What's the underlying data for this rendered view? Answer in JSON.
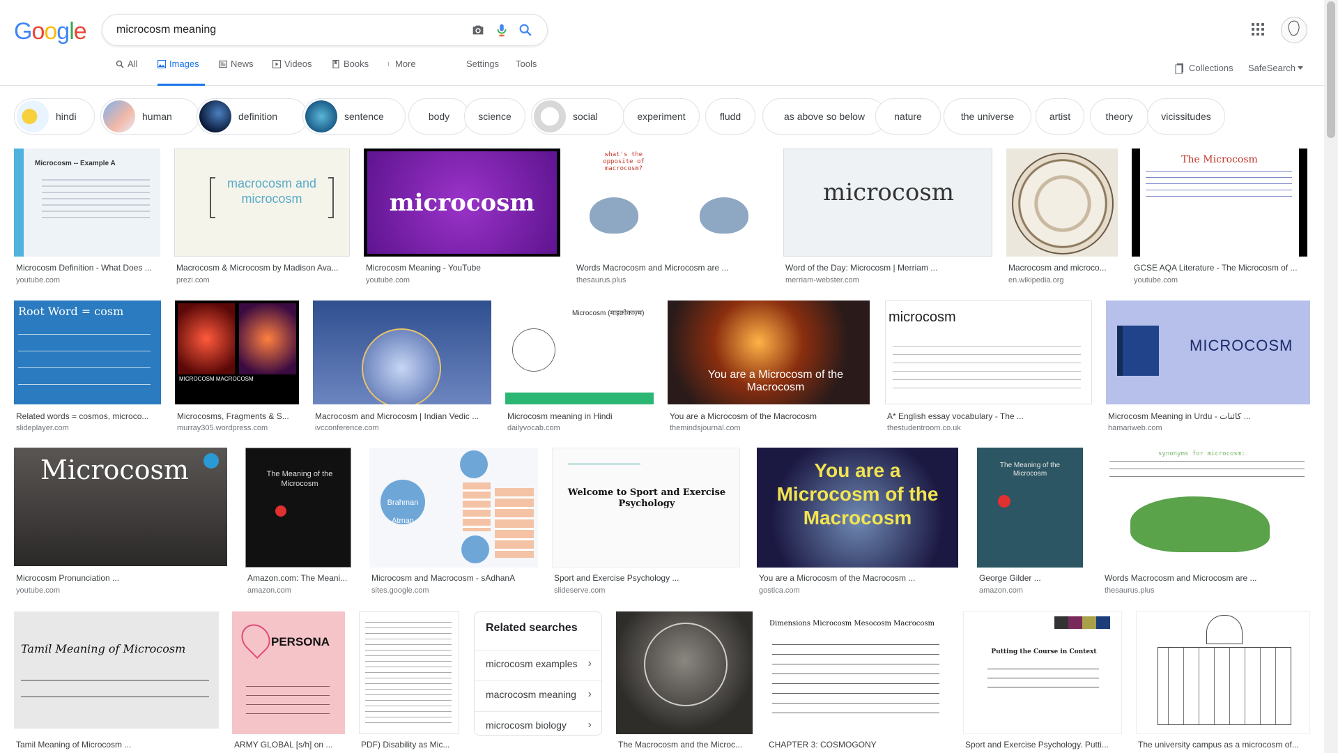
{
  "logo": {
    "letters": [
      "G",
      "o",
      "o",
      "g",
      "l",
      "e"
    ],
    "colors": [
      "#4285F4",
      "#EA4335",
      "#FBBC05",
      "#4285F4",
      "#34A853",
      "#EA4335"
    ]
  },
  "search": {
    "query": "microcosm meaning"
  },
  "tabs": [
    {
      "label": "All",
      "icon": "search-icon"
    },
    {
      "label": "Images",
      "icon": "image-icon",
      "active": true
    },
    {
      "label": "News",
      "icon": "news-icon"
    },
    {
      "label": "Videos",
      "icon": "video-icon"
    },
    {
      "label": "Books",
      "icon": "book-icon"
    },
    {
      "label": "More",
      "icon": "more-icon"
    }
  ],
  "tools": {
    "settings": "Settings",
    "tools": "Tools",
    "collections": "Collections",
    "safesearch": "SafeSearch"
  },
  "chips": [
    "hindi",
    "human",
    "definition",
    "sentence",
    "body",
    "science",
    "social",
    "experiment",
    "fludd",
    "as above so below",
    "nature",
    "the universe",
    "artist",
    "theory",
    "vicissitudes"
  ],
  "results": {
    "row1": [
      {
        "title": "Microcosm Definition - What Does ...",
        "source": "youtube.com",
        "text": "Microcosm -- Example A"
      },
      {
        "title": "Macrocosm & Microcosm by Madison Ava...",
        "source": "prezi.com",
        "text": "macrocosm and microcosm"
      },
      {
        "title": "Microcosm Meaning - YouTube",
        "source": "youtube.com",
        "text": "microcosm"
      },
      {
        "title": "Words Macrocosm and Microcosm are ...",
        "source": "thesaurus.plus",
        "text": "what's the opposite of macrocosm?"
      },
      {
        "title": "Word of the Day: Microcosm | Merriam ...",
        "source": "merriam-webster.com",
        "text": "microcosm"
      },
      {
        "title": "Macrocosm and microco...",
        "source": "en.wikipedia.org",
        "text": ""
      },
      {
        "title": "GCSE AQA Literature - The Microcosm of ...",
        "source": "youtube.com",
        "text": "The Microcosm"
      }
    ],
    "row2": [
      {
        "title": "Related words = cosmos, microco...",
        "source": "slideplayer.com",
        "text": "Root Word = cosm"
      },
      {
        "title": "Microcosms, Fragments & S...",
        "source": "murray305.wordpress.com",
        "text": "MICROCOSM  MACROCOSM"
      },
      {
        "title": "Macrocosm and Microcosm | Indian Vedic ...",
        "source": "ivcconference.com",
        "text": ""
      },
      {
        "title": "Microcosm meaning in Hindi",
        "source": "dailyvocab.com",
        "text": "Microcosm (माइक्रोकाज़्म)"
      },
      {
        "title": "You are a Microcosm of the Macrocosm",
        "source": "themindsjournal.com",
        "text": "You are a Microcosm of the Macrocosm"
      },
      {
        "title": "A* English essay vocabulary - The ...",
        "source": "thestudentroom.co.uk",
        "text": "microcosm"
      },
      {
        "title": "Microcosm Meaning in Urdu - کائنات ...",
        "source": "hamariweb.com",
        "text": "MICROCOSM"
      }
    ],
    "row3": [
      {
        "title": "Microcosm Pronunciation ...",
        "source": "youtube.com",
        "text": "Microcosm"
      },
      {
        "title": "Amazon.com: The Meani...",
        "source": "amazon.com",
        "text": "The Meaning of the Microcosm"
      },
      {
        "title": "Microcosm and Macrocosm - sAdhanA",
        "source": "sites.google.com",
        "text": "Brahman  Atman"
      },
      {
        "title": "Sport and Exercise Psychology ...",
        "source": "slideserve.com",
        "text": "Welcome to Sport and Exercise Psychology"
      },
      {
        "title": "You are a Microcosm of the Macrocosm ...",
        "source": "gostica.com",
        "text": "You are a Microcosm of the Macrocosm"
      },
      {
        "title": "George Gilder ...",
        "source": "amazon.com",
        "text": "The Meaning of the Microcosm"
      },
      {
        "title": "Words Macrocosm and Microcosm are ...",
        "source": "thesaurus.plus",
        "text": "synonyms for microcosm:"
      }
    ],
    "row4": [
      {
        "title": "Tamil Meaning of Microcosm ...",
        "source": "",
        "text": "Tamil Meaning of Microcosm"
      },
      {
        "title": "ARMY GLOBAL [s/h] on ...",
        "source": "",
        "text": "PERSONA"
      },
      {
        "title": "PDF) Disability as Mic...",
        "source": "",
        "text": ""
      },
      {
        "title": "The Macrocosm and the Microc...",
        "source": "",
        "text": ""
      },
      {
        "title": "CHAPTER 3: COSMOGONY",
        "source": "",
        "text": "Dimensions  Microcosm  Mesocosm  Macrocosm"
      },
      {
        "title": "Sport and Exercise Psychology. Putti...",
        "source": "",
        "text": "Putting the Course in Context"
      },
      {
        "title": "The university campus as a microcosm of...",
        "source": "",
        "text": ""
      }
    ]
  },
  "related": {
    "heading": "Related searches",
    "items": [
      "microcosm examples",
      "macrocosm meaning",
      "microcosm biology"
    ]
  }
}
